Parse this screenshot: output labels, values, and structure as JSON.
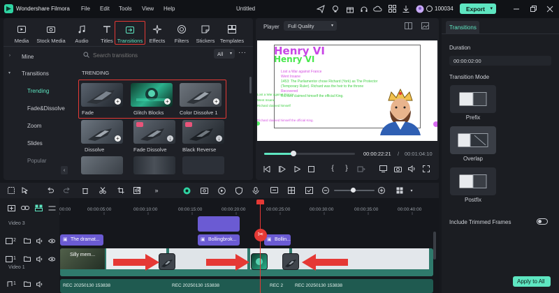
{
  "app": {
    "name": "Wondershare Filmora",
    "menu": [
      "File",
      "Edit",
      "Tools",
      "View",
      "Help"
    ],
    "doc_title": "Untitled",
    "credits": "100034",
    "export_label": "Export"
  },
  "tool_tabs": [
    "Media",
    "Stock Media",
    "Audio",
    "Titles",
    "Transitions",
    "Effects",
    "Filters",
    "Stickers",
    "Templates"
  ],
  "sidebar": {
    "items": [
      {
        "label": "Mine"
      },
      {
        "label": "Transitions"
      },
      {
        "label": "Trending"
      },
      {
        "label": "Fade&Dissolve"
      },
      {
        "label": "Zoom"
      },
      {
        "label": "Slides"
      },
      {
        "label": "Popular"
      }
    ]
  },
  "search": {
    "placeholder": "Search transitions",
    "filter": "All"
  },
  "section_title": "TRENDING",
  "transitions": [
    {
      "label": "Fade"
    },
    {
      "label": "Glitch Blocks"
    },
    {
      "label": "Color Dissolve 1"
    },
    {
      "label": "Dissolve"
    },
    {
      "label": "Fade Dissolve"
    },
    {
      "label": "Black Reverse"
    }
  ],
  "player": {
    "label": "Player",
    "quality": "Full Quality",
    "current_time": "00:00:22:21",
    "separator": "/",
    "total_time": "00:01:04:10",
    "progress": 0.32,
    "preview": {
      "title_back": "Henry VI",
      "title_front": "Henry VI",
      "bullets": [
        "Lost a War against France",
        "Went Insane",
        "1453: The Parliamentor chose Richard (York) as The Protector (Temporary Ruler). Richard was the heir to the throne",
        "Recovered",
        "Richard claimed himself the official King.",
        "Richard claimed himself the official King."
      ],
      "left_notes": [
        "Lost a War against France",
        "Went Insane",
        "Richard claimed himself"
      ]
    }
  },
  "properties": {
    "tab": "Transitions",
    "duration_label": "Duration",
    "duration_value": "00:00:02:00",
    "mode_label": "Transition Mode",
    "modes": [
      {
        "label": "Prefix"
      },
      {
        "label": "Overlap"
      },
      {
        "label": "Postfix"
      }
    ],
    "selected_mode": "Overlap",
    "include_trimmed_label": "Include Trimmed Frames",
    "include_trimmed": false,
    "apply_all_label": "Apply to All"
  },
  "timeline": {
    "ruler": [
      "00:00",
      "00:00:05:00",
      "00:00:10:00",
      "00:00:15:00",
      "00:00:20:00",
      "00:00:25:00",
      "00:00:30:00",
      "00:00:35:00",
      "00:00:40:00"
    ],
    "tracks": [
      {
        "label": "Video 3"
      },
      {
        "label": "2"
      },
      {
        "label": "1"
      },
      {
        "label": "Video 1"
      },
      {
        "label": "1"
      }
    ],
    "title_clips": [
      "The dramat...",
      "Bollingbrok...",
      "Bollin..."
    ],
    "video_clip_label": "Silly mem...",
    "audio_clips": [
      "REC 20250130 153838",
      "REC 20250130 153838",
      "REC 2",
      "REC 20250130 153838"
    ]
  },
  "colors": {
    "accent": "#5ee6c1",
    "highlight": "#e53935",
    "title_clip": "#6b5bd3",
    "video_track": "#2f7a6c"
  }
}
